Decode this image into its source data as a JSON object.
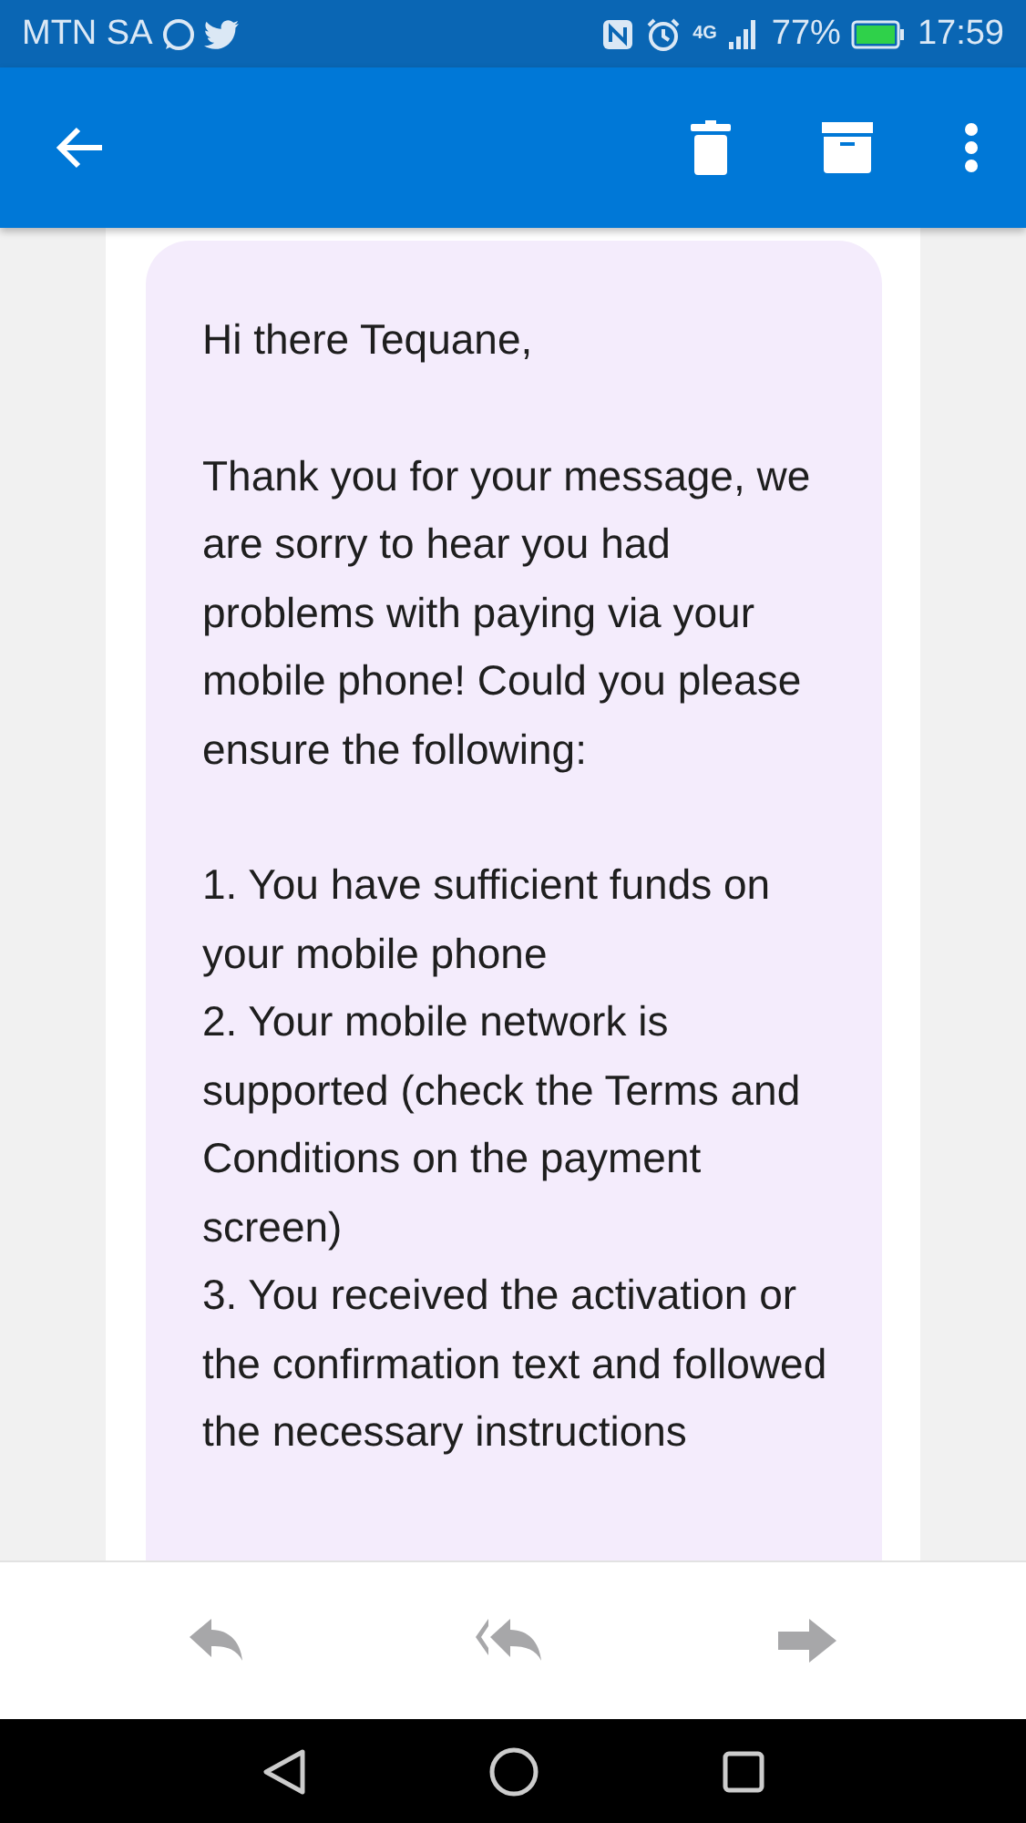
{
  "status_bar": {
    "carrier": "MTN SA",
    "network": "4G",
    "battery": "77%",
    "time": "17:59"
  },
  "message": {
    "greeting": "Hi there Tequane,",
    "paragraphs": [
      "Thank you for your message, we are sorry to hear you had problems with paying via your mobile phone! Could you please ensure the following:"
    ],
    "list_items": [
      "1. You have sufficient funds on your mobile phone",
      "2. Your mobile network is supported (check the Terms and Conditions on the payment screen)",
      "3. You received the activation or the confirmation text and followed the necessary instructions"
    ]
  }
}
